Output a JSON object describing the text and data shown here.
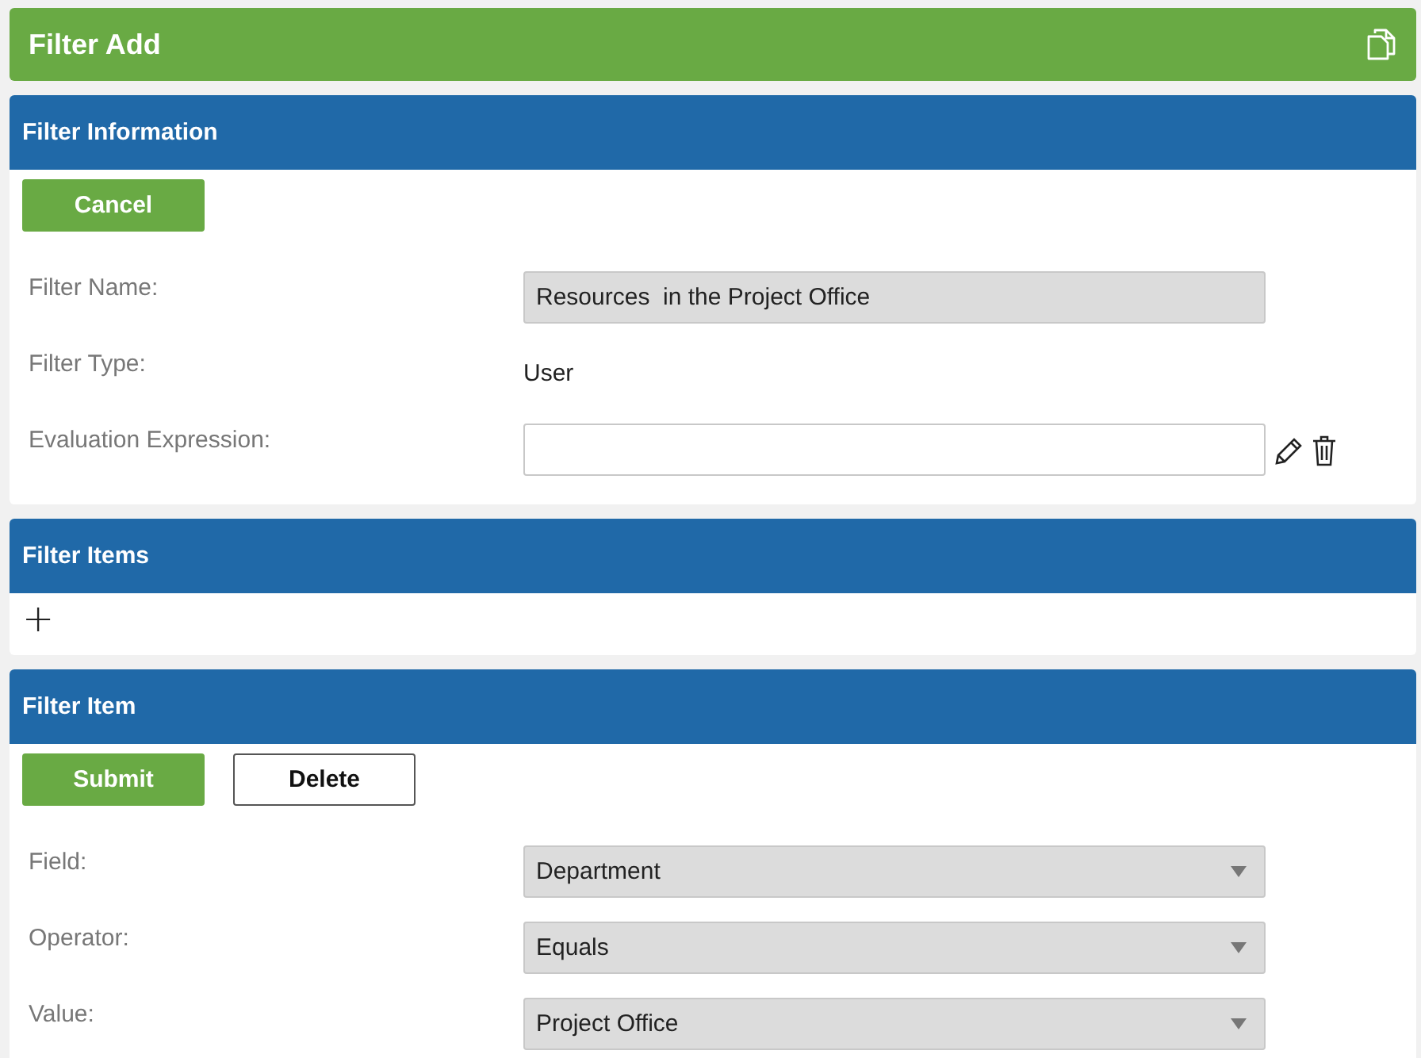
{
  "header": {
    "title": "Filter Add"
  },
  "filter_information": {
    "title": "Filter Information",
    "buttons": [
      {
        "label": "Cancel",
        "kind": "primary"
      }
    ],
    "fields": [
      {
        "label": "Filter Name:",
        "kind": "readonly",
        "value": "Resources  in the Project Office"
      },
      {
        "label": "Filter Type:",
        "kind": "text",
        "value": "User"
      },
      {
        "label": "Evaluation Expression:",
        "kind": "input"
      }
    ]
  },
  "filter_items": {
    "title": "Filter Items",
    "add": "+"
  },
  "filter_item": {
    "title": "Filter Item",
    "buttons": [
      {
        "label": "Submit",
        "kind": "primary"
      },
      {
        "label": "Delete",
        "kind": "secondary"
      }
    ],
    "fields": [
      {
        "label": "Field:",
        "kind": "select",
        "value": "Department"
      },
      {
        "label": "Operator:",
        "kind": "select",
        "value": "Equals"
      },
      {
        "label": "Value:",
        "kind": "select",
        "value": "Project Office"
      }
    ]
  }
}
